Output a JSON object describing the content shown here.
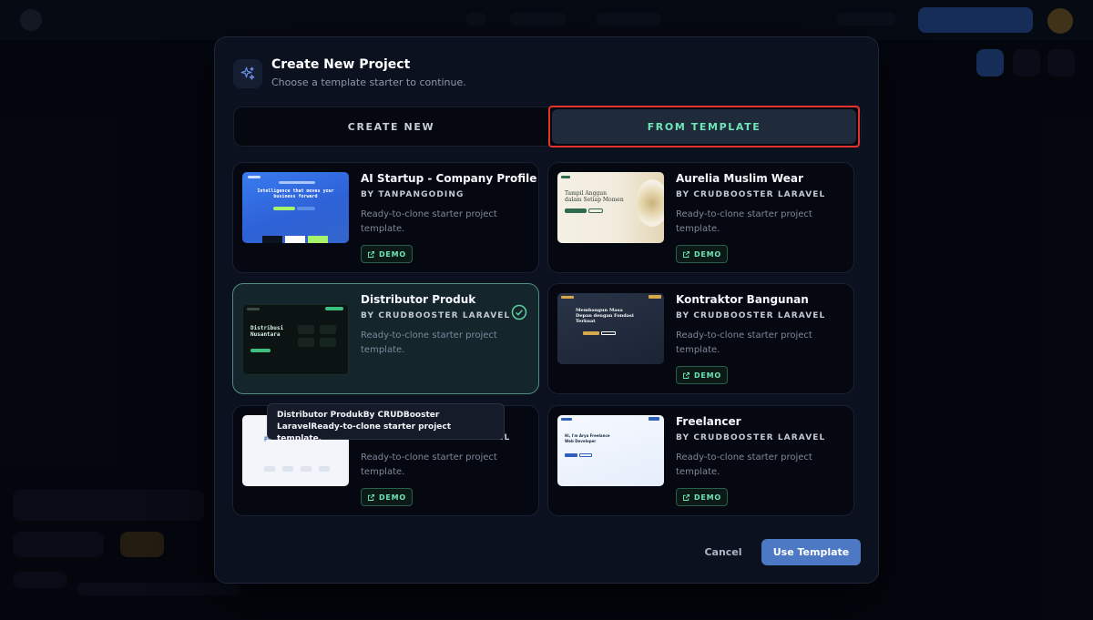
{
  "modal": {
    "title": "Create New Project",
    "subtitle": "Choose a template starter to continue.",
    "icon": "sparkles-icon"
  },
  "tabs": {
    "create_new": "CREATE NEW",
    "from_template": "FROM TEMPLATE",
    "active": "from_template"
  },
  "templates": [
    {
      "name": "AI Startup - Company Profile",
      "author": "BY TANPANGODING",
      "description": "Ready-to-clone starter project template.",
      "demo_label": "DEMO",
      "thumb_headline": "Intelligence that moves your business forward",
      "selected": false
    },
    {
      "name": "Aurelia Muslim Wear",
      "author": "BY CRUDBOOSTER LARAVEL",
      "description": "Ready-to-clone starter project template.",
      "demo_label": "DEMO",
      "thumb_headline": "Tampil Anggun dalam Setiap Momen",
      "selected": false
    },
    {
      "name": "Distributor Produk",
      "author": "BY CRUDBOOSTER LARAVEL",
      "description": "Ready-to-clone starter project template.",
      "demo_label": "DEMO",
      "thumb_headline": "Distribusi Nusantara",
      "selected": true
    },
    {
      "name": "Kontraktor Bangunan",
      "author": "BY CRUDBOOSTER LARAVEL",
      "description": "Ready-to-clone starter project template.",
      "demo_label": "DEMO",
      "thumb_headline": "Membangun Masa Depan dengan Fondasi Terkuat",
      "selected": false
    },
    {
      "name": "",
      "author": "BY CRUDBOOSTER LARAVEL",
      "description": "Ready-to-clone starter project template.",
      "demo_label": "DEMO",
      "thumb_headline": "products that scale",
      "selected": false
    },
    {
      "name": "Freelancer",
      "author": "BY CRUDBOOSTER LARAVEL",
      "description": "Ready-to-clone starter project template.",
      "demo_label": "DEMO",
      "thumb_headline": "Hi, I'm Arya Freelance Web Developer",
      "selected": false
    }
  ],
  "tooltip": {
    "text": "Distributor ProdukBy CRUDBooster LaravelReady-to-clone starter project template."
  },
  "footer": {
    "cancel_label": "Cancel",
    "use_label": "Use Template"
  },
  "colors": {
    "accent_green": "#6ee7b7",
    "primary_button": "#4d78c4",
    "highlight_border": "#e5322d"
  }
}
